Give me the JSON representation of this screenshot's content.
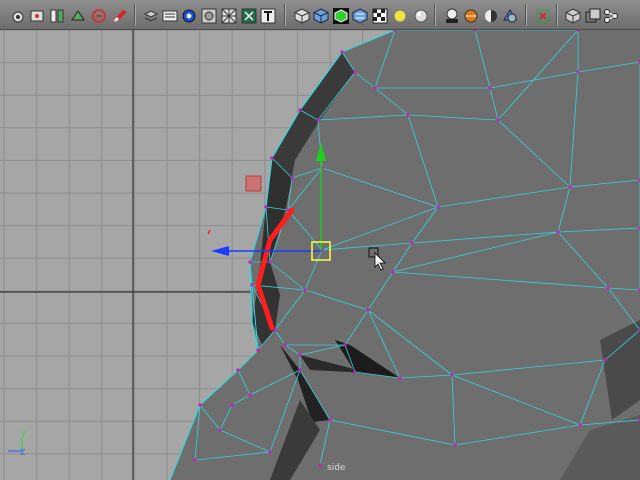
{
  "toolbar": {
    "buttons": [
      {
        "name": "snap-to-curves-icon"
      },
      {
        "name": "snap-to-points-icon"
      },
      {
        "name": "snap-to-view-planes-icon"
      },
      {
        "name": "make-live-icon"
      },
      {
        "name": "history-on-icon"
      },
      {
        "name": "render-current-frame-icon"
      },
      {
        "name": "select-camera-icon"
      },
      {
        "name": "camera-attributes-icon"
      },
      {
        "name": "bookmark-icon"
      },
      {
        "name": "image-plane-icon"
      },
      {
        "name": "grid-icon"
      },
      {
        "name": "film-gate-icon"
      },
      {
        "name": "resolution-gate-icon"
      },
      {
        "name": "field-chart-icon"
      },
      {
        "name": "wireframe-icon"
      },
      {
        "name": "smooth-shade-icon"
      },
      {
        "name": "wireframe-on-shaded-icon"
      },
      {
        "name": "textured-icon"
      },
      {
        "name": "use-default-lighting-icon"
      },
      {
        "name": "shadows-icon"
      },
      {
        "name": "high-quality-icon"
      },
      {
        "name": "xray-icon"
      },
      {
        "name": "backface-icon"
      },
      {
        "name": "isolate-select-icon"
      },
      {
        "name": "two-side-lighting-icon"
      },
      {
        "name": "ambient-occlusion-icon"
      },
      {
        "name": "show-manipulators-icon"
      },
      {
        "name": "gate-mask-icon"
      },
      {
        "name": "hud-icon"
      }
    ]
  },
  "viewport": {
    "camera_label": "side",
    "axis_labels": {
      "y": "Y",
      "x": "Z"
    },
    "colors": {
      "grid_bg": "#a6a6a6",
      "grid_line": "#8e8e8e",
      "grid_major": "#333333",
      "mesh_fill": "#6e6e6e",
      "wire": "#34d6dc",
      "vertex": "#c020c0",
      "selected_edge": "#ff1e1e",
      "manip_y": "#1ecf1e",
      "manip_x": "#1a3cff",
      "manip_center": "#ffff40"
    }
  }
}
